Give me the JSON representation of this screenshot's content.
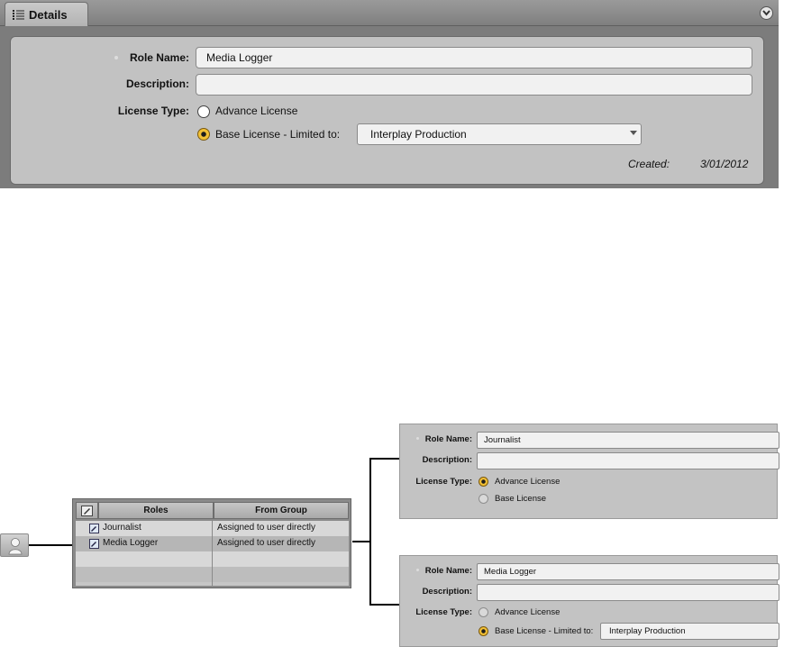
{
  "details_panel": {
    "tab_label": "Details",
    "tab_icon": "list-icon",
    "menu_icon": "chevron-down-icon",
    "role_name_label": "Role Name:",
    "role_name_value": "Media Logger",
    "description_label": "Description:",
    "description_value": "",
    "license_type_label": "License Type:",
    "advance_license_label": "Advance License",
    "base_license_label": "Base License - Limited to:",
    "base_license_selected": true,
    "limited_to_value": "Interplay Production",
    "created_label": "Created:",
    "created_value": "3/01/2012"
  },
  "diagram": {
    "user_icon": "user-icon",
    "roles_table": {
      "edit_icon": "edit-icon",
      "headers": [
        "Roles",
        "From Group"
      ],
      "rows": [
        {
          "role": "Journalist",
          "from_group": "Assigned to user directly",
          "icon": "role-icon"
        },
        {
          "role": "Media Logger",
          "from_group": "Assigned to user directly",
          "icon": "role-icon"
        }
      ]
    },
    "role_panels": [
      {
        "role_name_label": "Role Name:",
        "role_name_value": "Journalist",
        "description_label": "Description:",
        "description_value": "",
        "license_type_label": "License Type:",
        "advance_license_label": "Advance License",
        "base_license_label": "Base License",
        "selected": "advance"
      },
      {
        "role_name_label": "Role Name:",
        "role_name_value": "Media Logger",
        "description_label": "Description:",
        "description_value": "",
        "license_type_label": "License Type:",
        "advance_license_label": "Advance License",
        "base_license_label": "Base License - Limited to:",
        "limited_to_value": "Interplay Production",
        "selected": "base"
      }
    ]
  },
  "colors": {
    "panel_background": "#c2c2c2",
    "radio_selected": "#f2c035",
    "connector_lines": "#000000"
  }
}
